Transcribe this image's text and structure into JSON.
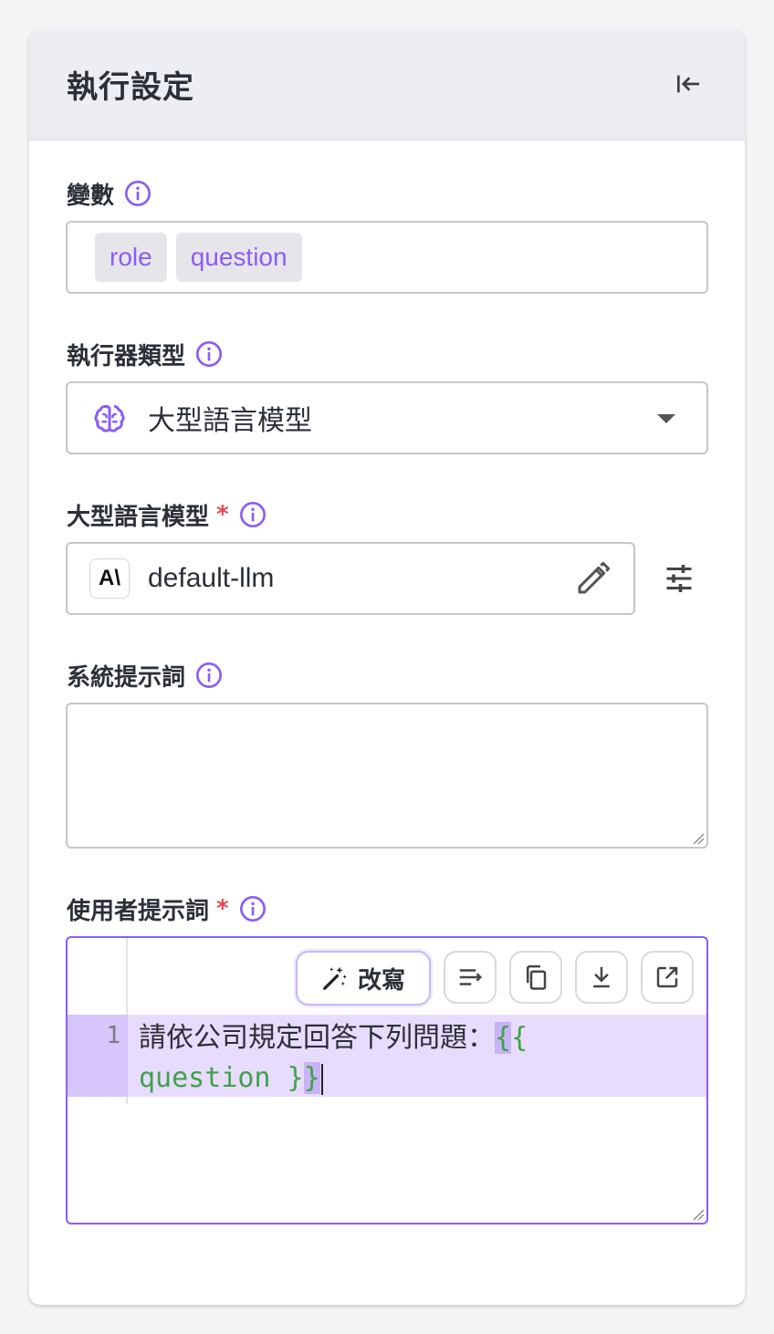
{
  "panel": {
    "title": "執行設定"
  },
  "variables": {
    "label": "變數",
    "chips": [
      "role",
      "question"
    ]
  },
  "executor_type": {
    "label": "執行器類型",
    "value": "大型語言模型",
    "icon": "brain-icon"
  },
  "llm": {
    "label": "大型語言模型",
    "required_mark": "*",
    "model_logo_text": "A\\",
    "value": "default-llm"
  },
  "system_prompt": {
    "label": "系統提示詞",
    "value": ""
  },
  "user_prompt": {
    "label": "使用者提示詞",
    "required_mark": "*",
    "rewrite_label": "改寫",
    "line_number": "1",
    "line_text": "請依公司規定回答下列問題：",
    "template_open": "{{",
    "template_body": "question }",
    "template_close": "}"
  },
  "colors": {
    "accent": "#8b5cf6",
    "required": "#e5484d",
    "template_green": "#3fa24a",
    "active_line": "#e8dcfe"
  }
}
